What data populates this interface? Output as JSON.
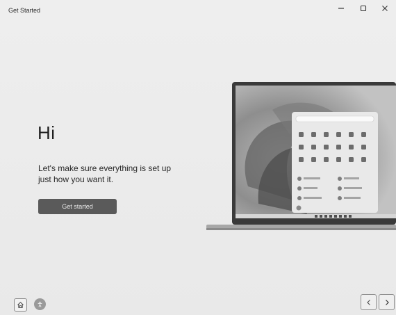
{
  "window": {
    "title": "Get Started"
  },
  "hero": {
    "title": "Hi",
    "subtitle": "Let's make sure everything is set up just how you want it.",
    "primary_button": "Get started"
  },
  "icons": {
    "minimize": "minimize-icon",
    "maximize": "maximize-icon",
    "close": "close-icon",
    "home": "home-icon",
    "accessibility": "accessibility-icon",
    "back": "chevron-left-icon",
    "next": "chevron-right-icon"
  },
  "colors": {
    "primary_button": "#5a5a5a",
    "background": "#ececec"
  }
}
